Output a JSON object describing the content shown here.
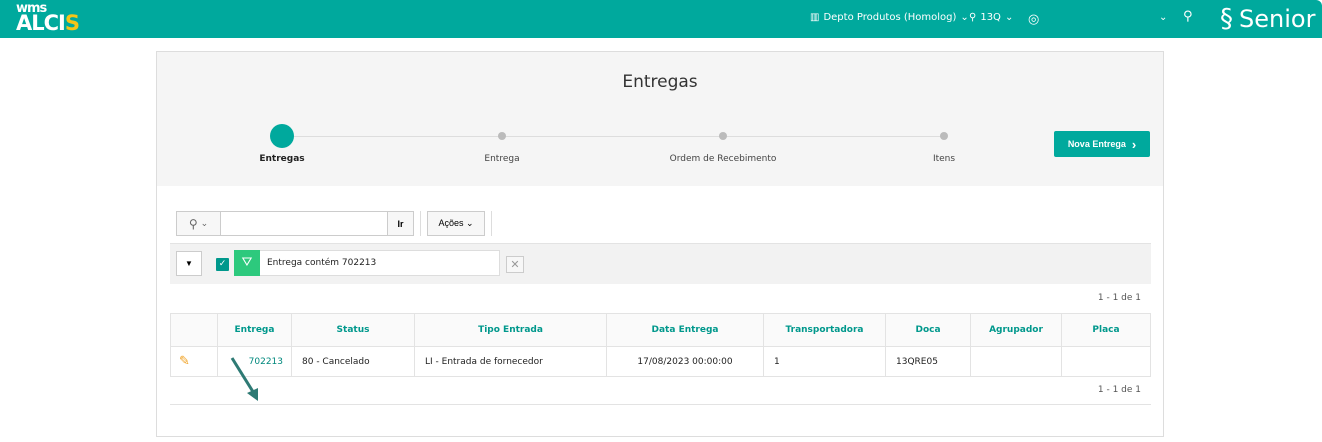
{
  "header": {
    "logo_top": "wms",
    "logo_main": "ALCI",
    "logo_accent": "S",
    "department": "Depto Produtos (Homolog)",
    "location": "13Q",
    "user": "",
    "brand": "Senior"
  },
  "page": {
    "title": "Entregas",
    "new_button": "Nova Entrega"
  },
  "steps": [
    {
      "label": "Entregas",
      "active": true
    },
    {
      "label": "Entrega"
    },
    {
      "label": "Ordem de Recebimento"
    },
    {
      "label": "Itens"
    }
  ],
  "toolbar": {
    "search_value": "",
    "go": "Ir",
    "actions": "Ações"
  },
  "filter": {
    "text": "Entrega contém 702213",
    "checked": true
  },
  "pagination": {
    "top": "1 - 1 de 1",
    "bottom": "1 - 1 de 1"
  },
  "table": {
    "columns": [
      "",
      "Entrega",
      "Status",
      "Tipo Entrada",
      "Data Entrega",
      "Transportadora",
      "Doca",
      "Agrupador",
      "Placa"
    ],
    "rows": [
      [
        "",
        "702213",
        "80 - Cancelado",
        "LI - Entrada de fornecedor",
        "17/08/2023 00:00:00",
        "1",
        "13QRE05",
        "",
        ""
      ]
    ]
  },
  "colors": {
    "brand": "#00a99d",
    "accent": "#f5c518"
  }
}
